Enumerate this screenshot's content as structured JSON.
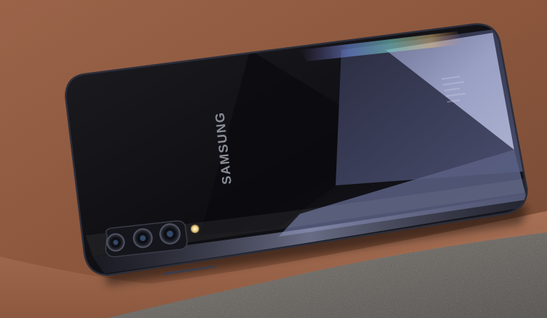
{
  "photo": {
    "brand_logo_text": "SAMSUNG",
    "colors": {
      "surface_top": "#9a5c42",
      "surface_dark": "#6a3e2c",
      "ledge_edge": "#b06e54",
      "ground_grey": "#5e5a55",
      "phone_body": "#141418",
      "phone_facet_light": "#8a8fb0",
      "phone_facet_mid": "#3c3f5a",
      "logo_grey": "#8a8c98",
      "flash": "#f6e6a8"
    }
  }
}
